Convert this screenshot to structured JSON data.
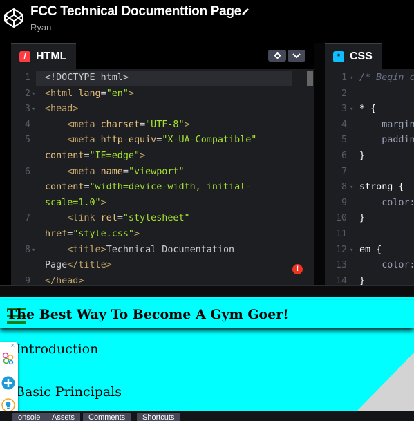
{
  "header": {
    "title": "FCC Technical Documenttion Page",
    "author": "Ryan"
  },
  "html_pane": {
    "tab_label": "HTML",
    "icon": "html-icon",
    "lines": [
      {
        "n": "1",
        "fold": false,
        "html": "<span class=\"t-doc\">&lt;!DOCTYPE html&gt;</span>"
      },
      {
        "n": "2",
        "fold": true,
        "html": "<span class=\"t-tag\">&lt;html</span> <span class=\"t-attr\">lang</span>=<span class=\"t-str\">\"en\"</span><span class=\"t-tag\">&gt;</span>"
      },
      {
        "n": "3",
        "fold": true,
        "html": "<span class=\"t-tag\">&lt;head&gt;</span>"
      },
      {
        "n": "4",
        "fold": false,
        "html": "    <span class=\"t-tag\">&lt;meta</span> <span class=\"t-attr\">charset</span>=<span class=\"t-str\">\"UTF-8\"</span><span class=\"t-tag\">&gt;</span>"
      },
      {
        "n": "5",
        "fold": false,
        "html": "    <span class=\"t-tag\">&lt;meta</span> <span class=\"t-attr\">http-equiv</span>=<span class=\"t-str\">\"X-UA-Compatible\"</span>"
      },
      {
        "n": "",
        "fold": false,
        "html": "<span class=\"t-attr\">content</span>=<span class=\"t-str\">\"IE=edge\"</span><span class=\"t-tag\">&gt;</span>"
      },
      {
        "n": "6",
        "fold": false,
        "html": "    <span class=\"t-tag\">&lt;meta</span> <span class=\"t-attr\">name</span>=<span class=\"t-str\">\"viewport\"</span>"
      },
      {
        "n": "",
        "fold": false,
        "html": "<span class=\"t-attr\">content</span>=<span class=\"t-str\">\"width=device-width, initial-</span>"
      },
      {
        "n": "",
        "fold": false,
        "html": "<span class=\"t-str\">scale=1.0\"</span><span class=\"t-tag\">&gt;</span>"
      },
      {
        "n": "7",
        "fold": false,
        "html": "    <span class=\"t-tag\">&lt;link</span> <span class=\"t-attr\">rel</span>=<span class=\"t-str\">\"stylesheet\"</span>"
      },
      {
        "n": "",
        "fold": false,
        "html": "<span class=\"t-attr\">href</span>=<span class=\"t-str\">\"style.css\"</span><span class=\"t-tag\">&gt;</span>"
      },
      {
        "n": "8",
        "fold": true,
        "html": "    <span class=\"t-tag\">&lt;title&gt;</span>Technical Documentation"
      },
      {
        "n": "",
        "fold": false,
        "html": "Page<span class=\"t-tag\">&lt;/title&gt;</span>"
      },
      {
        "n": "9",
        "fold": false,
        "html": "<span class=\"t-tag\">&lt;/head&gt;</span>"
      }
    ]
  },
  "css_pane": {
    "tab_label": "CSS",
    "icon": "css-icon",
    "lines": [
      {
        "n": "1",
        "fold": true,
        "html": "<span class=\"t-com\">/* Begin c</span>"
      },
      {
        "n": "2",
        "fold": false,
        "html": ""
      },
      {
        "n": "3",
        "fold": true,
        "html": "<span class=\"t-sel\">* {</span>"
      },
      {
        "n": "4",
        "fold": false,
        "html": "    <span class=\"t-prop\">margin</span>"
      },
      {
        "n": "5",
        "fold": false,
        "html": "    <span class=\"t-prop\">paddin</span>"
      },
      {
        "n": "6",
        "fold": false,
        "html": "<span class=\"t-sel\">}</span>"
      },
      {
        "n": "7",
        "fold": false,
        "html": ""
      },
      {
        "n": "8",
        "fold": true,
        "html": "<span class=\"t-sel\">strong {</span>"
      },
      {
        "n": "9",
        "fold": false,
        "html": "    <span class=\"t-prop\">color:</span>"
      },
      {
        "n": "10",
        "fold": false,
        "html": "<span class=\"t-sel\">}</span>"
      },
      {
        "n": "11",
        "fold": false,
        "html": ""
      },
      {
        "n": "12",
        "fold": true,
        "html": "<span class=\"t-sel\">em {</span>"
      },
      {
        "n": "13",
        "fold": false,
        "html": "    <span class=\"t-prop\">color:</span>"
      },
      {
        "n": "14",
        "fold": false,
        "html": "<span class=\"t-sel\">}</span>"
      }
    ]
  },
  "preview": {
    "heading": "The Best Way To Become A Gym Goer!",
    "nav": [
      "Introduction",
      "Basic Principals"
    ],
    "background": "#00ffff"
  },
  "widget": {
    "close": "×"
  },
  "bottombar": {
    "buttons": [
      "onsole",
      "Assets",
      "Comments",
      "Shortcuts"
    ]
  },
  "error_badge": "!"
}
